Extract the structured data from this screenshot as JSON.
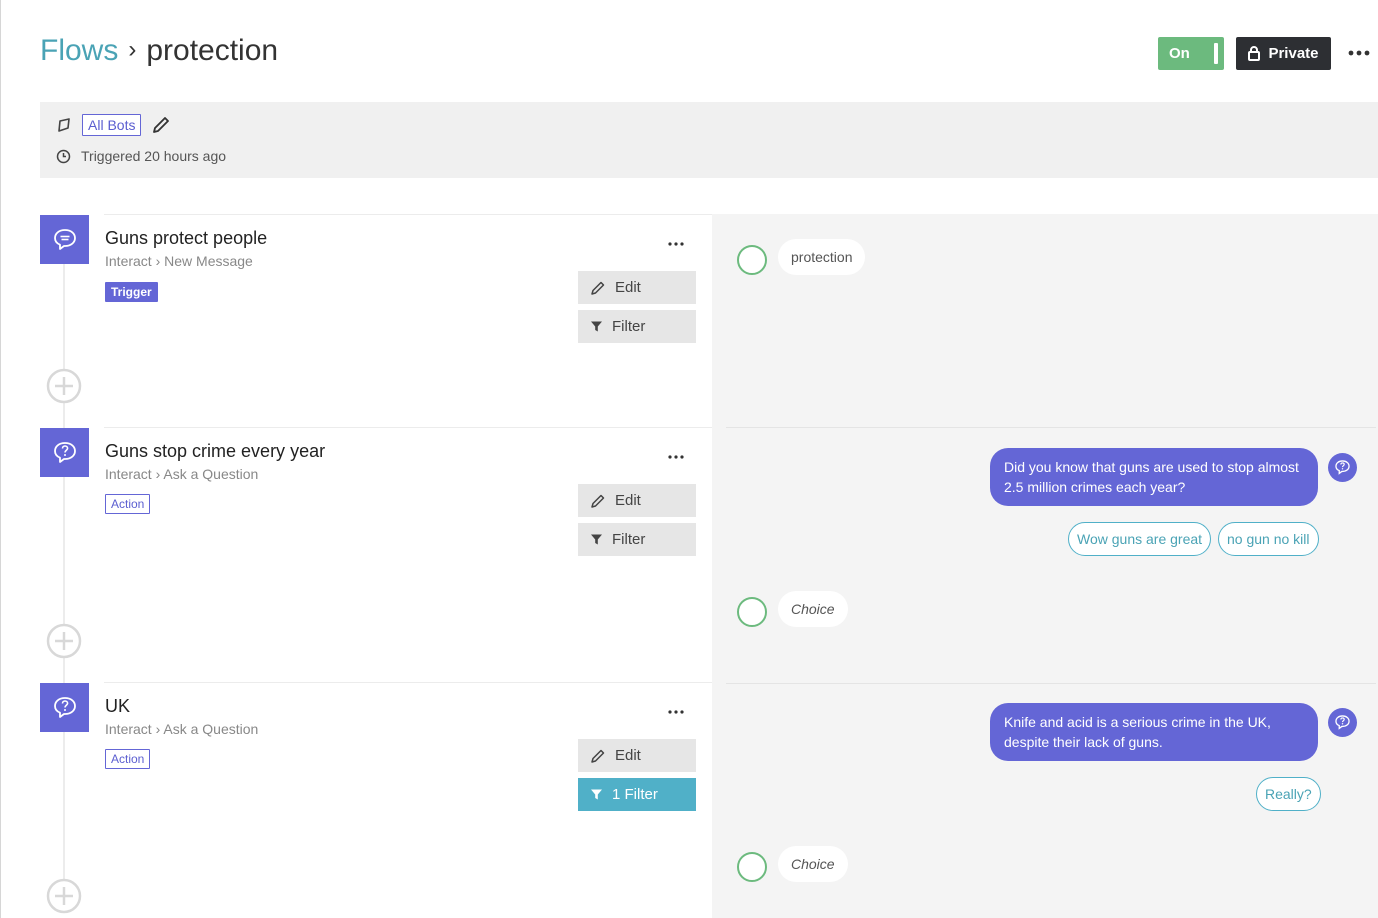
{
  "header": {
    "breadcrumb_root": "Flows",
    "breadcrumb_sep": "›",
    "breadcrumb_current": "protection",
    "toggle_label": "On",
    "private_label": "Private"
  },
  "info": {
    "bots_label": "All Bots",
    "triggered_text": "Triggered 20 hours ago"
  },
  "steps": [
    {
      "title": "Guns protect people",
      "subtitle": "Interact › New Message",
      "tag": "Trigger",
      "edit_label": "Edit",
      "filter_label": "Filter"
    },
    {
      "title": "Guns stop crime every year",
      "subtitle": "Interact › Ask a Question",
      "tag": "Action",
      "edit_label": "Edit",
      "filter_label": "Filter"
    },
    {
      "title": "UK",
      "subtitle": "Interact › Ask a Question",
      "tag": "Action",
      "edit_label": "Edit",
      "filter_label": "1 Filter"
    }
  ],
  "preview": {
    "trigger_message": "protection",
    "q1_text": "Did you know that guns are used to stop almost 2.5 million crimes each year?",
    "q1_choices": [
      "Wow guns are great",
      "no gun no kill"
    ],
    "choice_label_1": "Choice",
    "q2_text": "Knife and acid is a serious crime in the UK, despite their lack of guns.",
    "q2_choices": [
      "Really?"
    ],
    "choice_label_2": "Choice"
  },
  "colors": {
    "accent_purple": "#6466d6",
    "accent_teal": "#4aa3b5",
    "toggle_green": "#6cba7e",
    "private_dark": "#2d2f33"
  }
}
